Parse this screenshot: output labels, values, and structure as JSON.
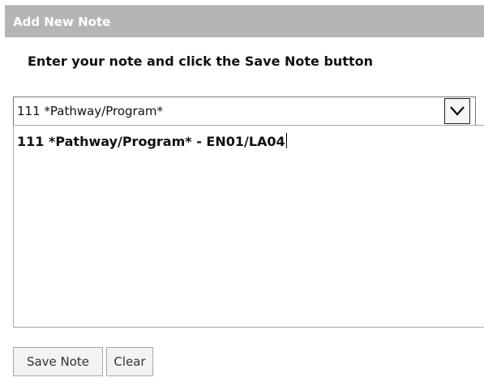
{
  "panel": {
    "title": "Add New Note",
    "instructions": "Enter your note and click the Save Note button"
  },
  "select": {
    "value": "111 *Pathway/Program*",
    "icon": "chevron-down-icon"
  },
  "note": {
    "value": "111 *Pathway/Program* - EN01/LA04"
  },
  "buttons": {
    "save_label": "Save Note",
    "clear_label": "Clear"
  },
  "colors": {
    "header_background": "#b5b5b5",
    "header_text": "#ffffff"
  }
}
